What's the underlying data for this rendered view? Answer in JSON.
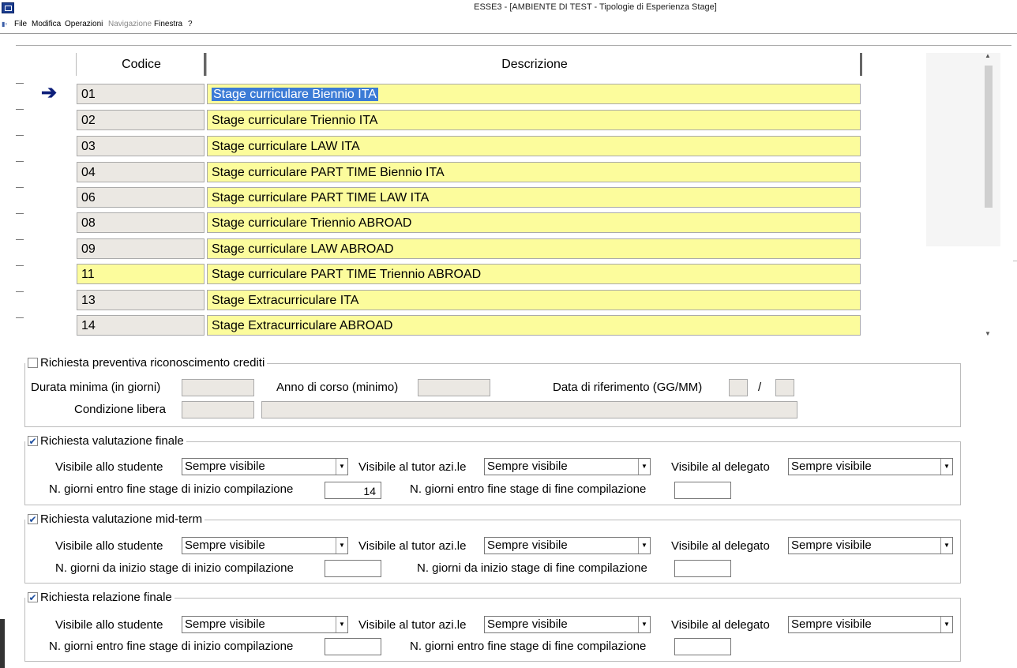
{
  "window": {
    "title": "ESSE3 - [AMBIENTE DI TEST - Tipologie di Esperienza Stage]"
  },
  "menu": [
    "File",
    "Modifica",
    "Operazioni",
    "Navigazione",
    "Finestra",
    "?"
  ],
  "grid": {
    "headers": {
      "code": "Codice",
      "description": "Descrizione"
    },
    "rows": [
      {
        "code": "01",
        "description": "Stage curriculare Biennio ITA"
      },
      {
        "code": "02",
        "description": "Stage curriculare Triennio ITA"
      },
      {
        "code": "03",
        "description": "Stage curriculare LAW ITA"
      },
      {
        "code": "04",
        "description": "Stage curriculare PART TIME Biennio ITA"
      },
      {
        "code": "06",
        "description": "Stage curriculare PART TIME LAW ITA"
      },
      {
        "code": "08",
        "description": "Stage curriculare Triennio ABROAD"
      },
      {
        "code": "09",
        "description": "Stage curriculare LAW ABROAD"
      },
      {
        "code": "11",
        "description": "Stage curriculare PART TIME Triennio ABROAD"
      },
      {
        "code": "13",
        "description": "Stage Extracurriculare ITA"
      },
      {
        "code": "14",
        "description": "Stage Extracurriculare ABROAD"
      }
    ]
  },
  "credits": {
    "label": "Richiesta preventiva riconoscimento crediti",
    "checked": false,
    "durata_label": "Durata minima (in giorni)",
    "anno_label": "Anno di corso (minimo)",
    "data_label": "Data di riferimento (GG/MM)",
    "slash": "/",
    "condizione_label": "Condizione libera"
  },
  "valutazione_finale": {
    "label": "Richiesta valutazione finale",
    "checkmark": "✔",
    "studente_label": "Visibile allo studente",
    "studente_value": "Sempre visibile",
    "tutor_label": "Visibile al tutor azi.le",
    "tutor_value": "Sempre visibile",
    "delegato_label": "Visibile al delegato",
    "delegato_value": "Sempre visibile",
    "inizio_label": "N. giorni entro fine stage di inizio compilazione",
    "inizio_value": "14",
    "fine_label": "N. giorni entro fine stage di fine compilazione",
    "fine_value": ""
  },
  "valutazione_mid": {
    "label": "Richiesta valutazione mid-term",
    "checkmark": "✔",
    "studente_label": "Visibile allo studente",
    "studente_value": "Sempre visibile",
    "tutor_label": "Visibile al tutor azi.le",
    "tutor_value": "Sempre visibile",
    "delegato_label": "Visibile al delegato",
    "delegato_value": "Sempre visibile",
    "inizio_label": "N. giorni da inizio stage di inizio compilazione",
    "inizio_value": "",
    "fine_label": "N. giorni da inizio stage di fine compilazione",
    "fine_value": ""
  },
  "relazione_finale": {
    "label": "Richiesta relazione finale",
    "checkmark": "✔",
    "studente_label": "Visibile allo studente",
    "studente_value": "Sempre visibile",
    "tutor_label": "Visibile al tutor azi.le",
    "tutor_value": "Sempre visibile",
    "delegato_label": "Visibile al delegato",
    "delegato_value": "Sempre visibile",
    "inizio_label": "N. giorni entro fine stage di inizio compilazione",
    "inizio_value": "",
    "fine_label": "N. giorni entro fine stage di fine compilazione",
    "fine_value": ""
  },
  "colors": {
    "highlight": "#fcfc9c",
    "readonly": "#ebe8e3",
    "selection": "#3b7bd6"
  }
}
